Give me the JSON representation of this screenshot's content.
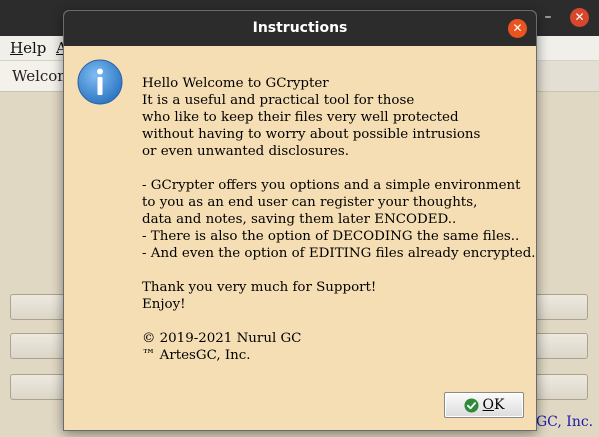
{
  "main_window": {
    "menu": {
      "help_mnemonic": "H",
      "help_rest": "elp",
      "second_partial": "A"
    },
    "tab_label": "Welcome",
    "footer_partial": "GC, Inc."
  },
  "dialog": {
    "title": "Instructions",
    "icon": "information-icon",
    "message_lines": [
      "Hello Welcome to GCrypter",
      "It is a useful and practical tool for those",
      "who like to keep their files very well protected",
      "without having to worry about possible intrusions",
      "or even unwanted disclosures.",
      "",
      "- GCrypter offers you options and a simple environment",
      "to you as an end user can register your thoughts,",
      "data and notes, saving them later ENCODED..",
      "- There is also the option of DECODING the same files..",
      "- And even the option of EDITING files already encrypted.",
      "",
      "Thank you very much for Support!",
      "Enjoy!",
      "",
      "© 2019-2021 Nurul GC",
      "™ ArtesGC, Inc."
    ],
    "ok_button": {
      "mnemonic": "O",
      "rest": "K",
      "icon": "check-icon"
    }
  },
  "colors": {
    "dialog_background": "#f5deb3",
    "titlebar": "#2c2c2c",
    "close_button": "#e95420",
    "info_blue": "#3f8fd8",
    "check_green": "#2e8b3a",
    "footer_link": "#1c1aa6"
  }
}
